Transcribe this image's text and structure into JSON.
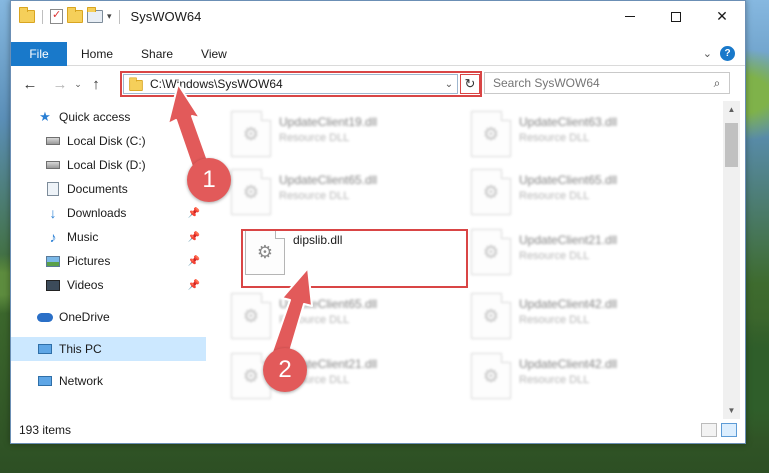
{
  "window": {
    "title": "SysWOW64",
    "minimize_glyph": "",
    "close_glyph": "✕"
  },
  "ribbon": {
    "tabs": [
      "File",
      "Home",
      "Share",
      "View"
    ],
    "help_glyph": "?"
  },
  "address": {
    "path": "C:\\Windows\\SysWOW64",
    "search_placeholder": "Search SysWOW64"
  },
  "nav": {
    "items": [
      {
        "label": "Quick access",
        "icon": "star-icon"
      },
      {
        "label": "Local Disk (C:)",
        "icon": "disk-icon"
      },
      {
        "label": "Local Disk (D:)",
        "icon": "disk-icon"
      },
      {
        "label": "Documents",
        "icon": "documents-icon"
      },
      {
        "label": "Downloads",
        "icon": "download-icon",
        "pinned": true
      },
      {
        "label": "Music",
        "icon": "music-icon",
        "pinned": true
      },
      {
        "label": "Pictures",
        "icon": "pictures-icon",
        "pinned": true
      },
      {
        "label": "Videos",
        "icon": "videos-icon",
        "pinned": true
      },
      {
        "label": "OneDrive",
        "icon": "cloud-icon"
      },
      {
        "label": "This PC",
        "icon": "computer-icon",
        "selected": true
      },
      {
        "label": "Network",
        "icon": "network-icon"
      }
    ]
  },
  "files": [
    {
      "name": "UpdateClient19.dll",
      "type": "Resource DLL"
    },
    {
      "name": "UpdateClient63.dll",
      "type": "Resource DLL"
    },
    {
      "name": "UpdateClient65.dll",
      "type": "Resource DLL"
    },
    {
      "name": "UpdateClient65.dll",
      "type": "Resource DLL"
    },
    {
      "name": "dipslib.dll",
      "type": ""
    },
    {
      "name": "UpdateClient21.dll",
      "type": "Resource DLL"
    },
    {
      "name": "UpdateClient65.dll",
      "type": "Resource DLL"
    },
    {
      "name": "UpdateClient42.dll",
      "type": "Resource DLL"
    },
    {
      "name": "UpdateClient21.dll",
      "type": "Resource DLL"
    },
    {
      "name": "UpdateClient42.dll",
      "type": "Resource DLL"
    }
  ],
  "status": {
    "item_count": "193 items"
  },
  "annotations": {
    "step1": "1",
    "step2": "2",
    "color": "#e25a5a"
  }
}
